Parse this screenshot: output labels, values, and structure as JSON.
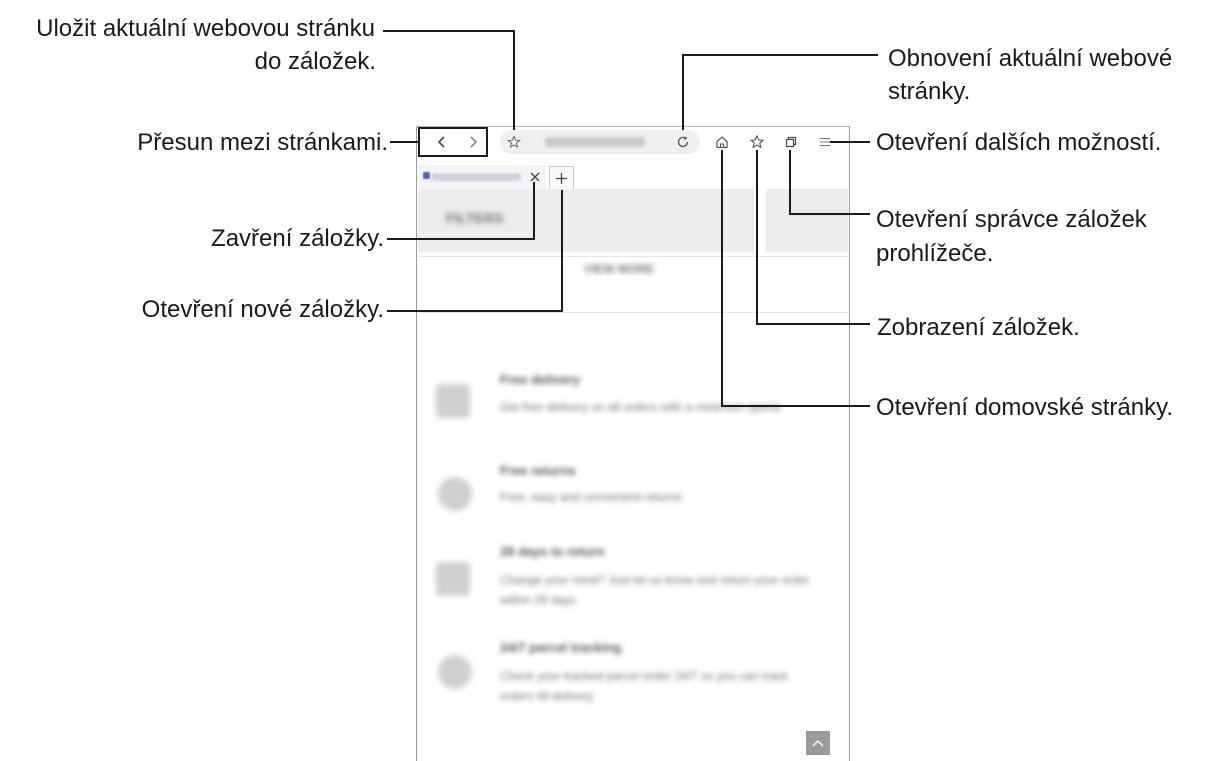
{
  "callouts": {
    "save_bookmark": "Uložit aktuální webovou stránku do záložek.",
    "save_bookmark_line1": "Uložit aktuální webovou stránku",
    "save_bookmark_line2": "do záložek.",
    "navigate": "Přesun mezi stránkami.",
    "close_tab": "Zavření záložky.",
    "new_tab": "Otevření nové záložky.",
    "refresh_line1": "Obnovení aktuální webové",
    "refresh_line2": "stránky.",
    "more_options": "Otevření dalších možností.",
    "tab_manager_line1": "Otevření správce záložek",
    "tab_manager_line2": "prohlížeče.",
    "bookmarks": "Zobrazení záložek.",
    "home": "Otevření domovské stránky."
  },
  "browser": {
    "icons": [
      "back-icon",
      "forward-icon",
      "star-icon",
      "refresh-icon",
      "home-icon",
      "bookmarks-icon",
      "tabs-icon",
      "menu-icon",
      "close-icon",
      "plus-icon",
      "chevron-up-icon"
    ]
  },
  "page": {
    "filters_label": "FILTERS",
    "view_more_label": "VIEW MORE",
    "features": [
      {
        "title": "Free delivery",
        "desc": "Get free delivery on all orders with a minimum spend"
      },
      {
        "title": "Free returns",
        "desc": "Free, easy and convenient returns"
      },
      {
        "title": "28 days to return",
        "desc": "Change your mind? Just let us know and return your order within 28 days"
      },
      {
        "title": "24/7 parcel tracking",
        "desc": "Check your tracked parcel order 24/7 so you can track orders till delivery"
      }
    ]
  }
}
